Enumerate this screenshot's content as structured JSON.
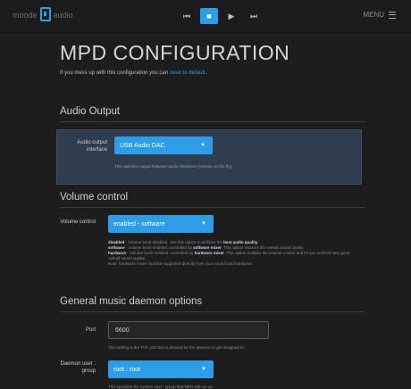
{
  "header": {
    "brand": "moode",
    "brand_suffix": "audio",
    "controls": [
      {
        "icon": "prev-icon",
        "glyph": "⏮"
      },
      {
        "icon": "stop-icon",
        "glyph": "■"
      },
      {
        "icon": "play-icon",
        "glyph": "▶"
      },
      {
        "icon": "next-icon",
        "glyph": "⏭"
      }
    ],
    "menu_label": "MENU"
  },
  "page": {
    "title": "MPD CONFIGURATION",
    "intro_prefix": "If you mess up with this configuration you can",
    "intro_link": "reset to default",
    "intro_suffix": "."
  },
  "audio_output": {
    "title": "Audio Output",
    "label": "Audio output interface",
    "selected": "USB Audio DAC",
    "help": "This switches output between audio interfaces (restarts on the fly)."
  },
  "volume_control": {
    "title": "Volume control",
    "label": "Volume control",
    "selected": "enabled - software",
    "help": [
      {
        "term": "disabled",
        "text": " - Volume knob disabled. Use this option to achieve the ",
        "bold": "best audio quality",
        "end": "."
      },
      {
        "term": "software",
        "text": " - Volume knob enabled, controlled by ",
        "bold": "software mixer",
        "end": ". This option reduces the overall sound quality."
      },
      {
        "term": "hardware",
        "text": " - Volume knob enabled, controlled by ",
        "bold": "hardware mixer",
        "end": ". This option enables the volume control and let you achieve very good overall sound quality."
      },
      {
        "term": "",
        "text": "Note: hardware mixer must be supported directly from your sound card hardware.",
        "bold": "",
        "end": ""
      }
    ]
  },
  "general": {
    "title": "General music daemon options",
    "port_label": "Port",
    "port_value": "6600",
    "port_help": "This setting is the TCP port that is desired for the daemon to get assigned to.",
    "user_label": "Daemon user : group",
    "user_selected": "root : root",
    "user_help": "This specifies the system user : group that MPD will run as."
  }
}
